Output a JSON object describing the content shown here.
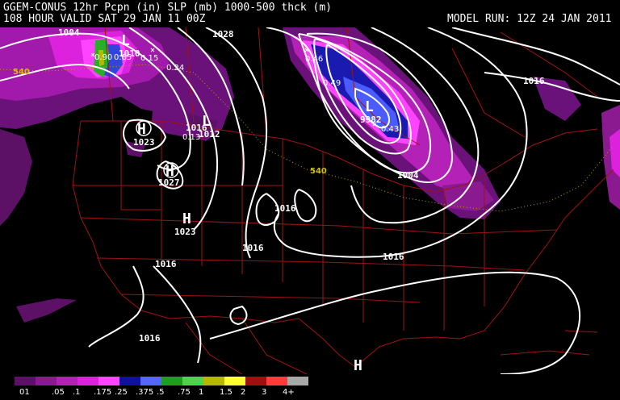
{
  "header": {
    "line1": "GGEM-CONUS 12hr Pcpn (in) SLP (mb) 1000-500 thck (m)",
    "line2": "108 HOUR VALID SAT 29 JAN 11 00Z",
    "model_run": "MODEL RUN: 12Z 24 JAN 2011"
  },
  "pressure_centers": [
    {
      "type": "L",
      "value": "1010"
    },
    {
      "type": "H",
      "value": "1023"
    },
    {
      "type": "L",
      "value": "1012"
    },
    {
      "type": "H",
      "value": "1027"
    },
    {
      "type": "H",
      "value": "1023"
    },
    {
      "type": "L",
      "value": "9982"
    },
    {
      "type": "H",
      "value": ""
    }
  ],
  "isobar_labels": [
    "1004",
    "1028",
    "1016",
    "1016",
    "1016",
    "1016",
    "1016",
    "1016",
    "1016",
    "1004"
  ],
  "thickness_labels": [
    "540",
    "540"
  ],
  "precip_labels": [
    "0.90",
    "0.65",
    "0.15",
    "0.24",
    "0.13",
    "0.46",
    "0.49",
    "0.43"
  ],
  "legend": {
    "labels": [
      "01",
      ".05",
      ".1",
      ".175",
      ".25",
      ".375",
      ".5",
      ".75",
      "1",
      "1.5",
      "2",
      "3",
      "4+"
    ],
    "colors": [
      "#5c1166",
      "#8b1a91",
      "#b321b7",
      "#dd22dd",
      "#ff44ff",
      "#0f0fa0",
      "#5566ff",
      "#1e9e1e",
      "#4cd44c",
      "#b8b800",
      "#ffff33",
      "#a01010",
      "#ff3b3b",
      "#a8a8a8"
    ]
  },
  "map_colors": {
    "background": "#000000",
    "borders": "#a01313",
    "isobars": "#ffffff",
    "thickness": "#b8a000"
  }
}
